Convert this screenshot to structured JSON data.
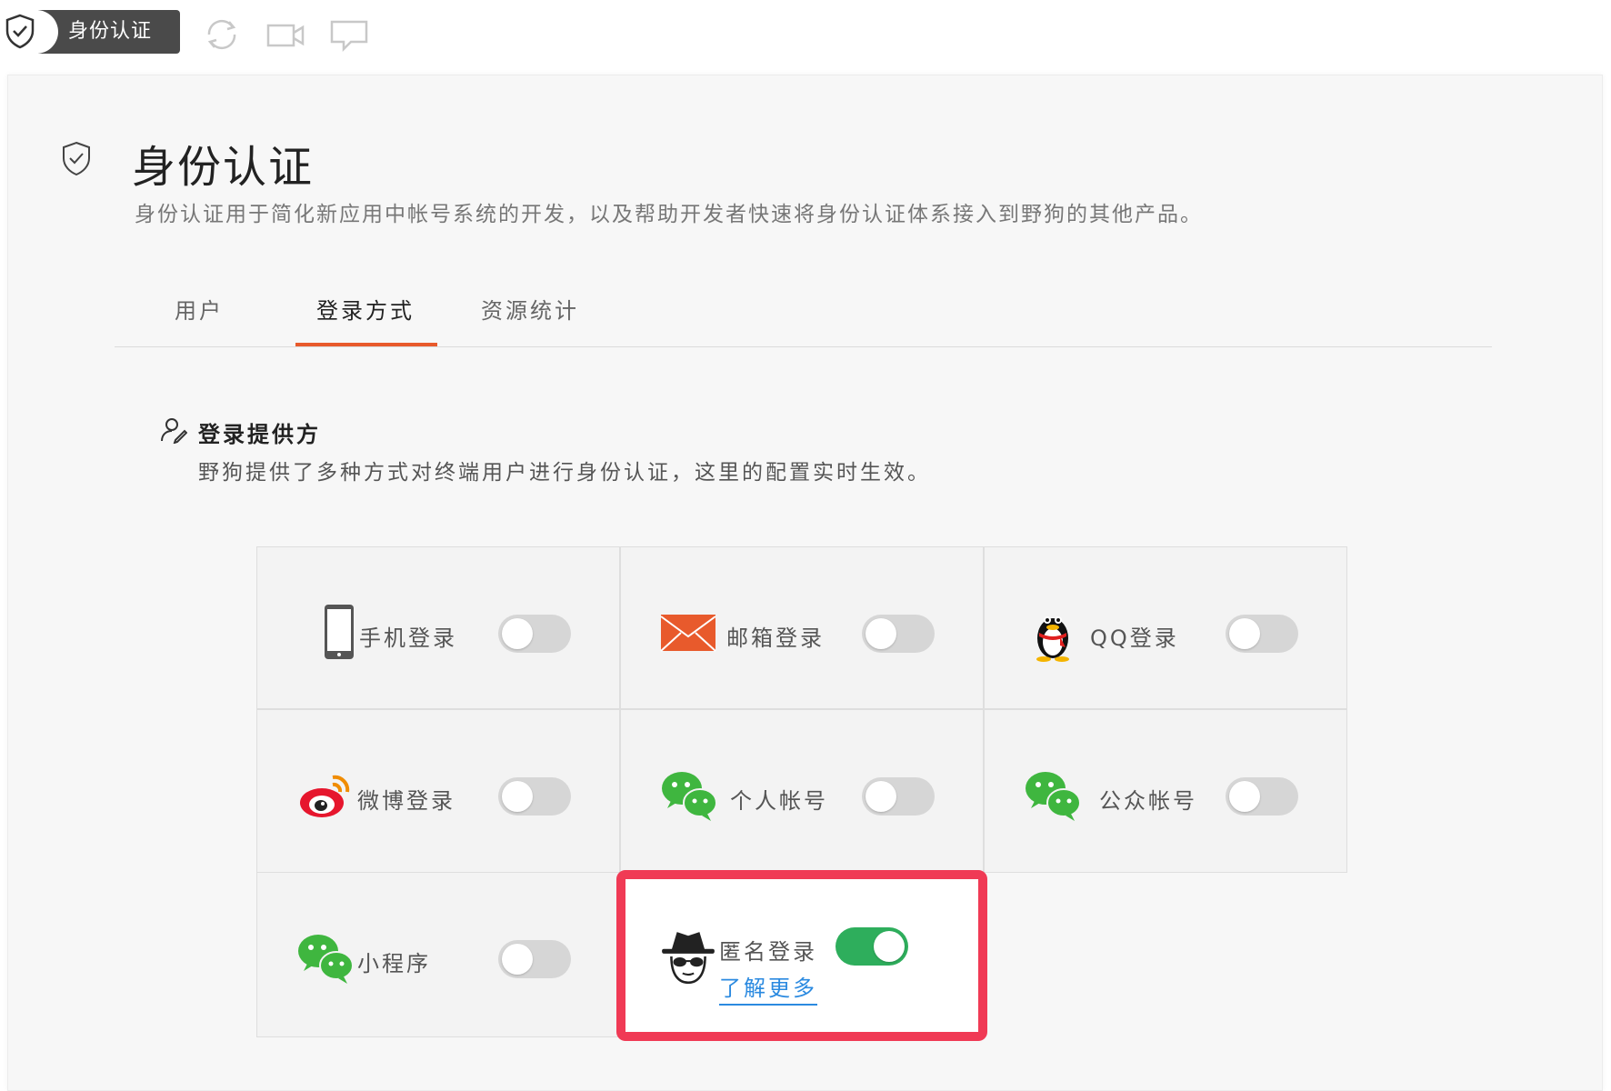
{
  "toolbar": {
    "active_tab": "身份认证",
    "icons": [
      "shield-icon",
      "refresh-icon",
      "video-icon",
      "chat-icon"
    ]
  },
  "header": {
    "title": "身份认证",
    "description": "身份认证用于简化新应用中帐号系统的开发，以及帮助开发者快速将身份认证体系接入到野狗的其他产品。"
  },
  "tabs": [
    {
      "label": "用户",
      "active": false
    },
    {
      "label": "登录方式",
      "active": true
    },
    {
      "label": "资源统计",
      "active": false
    }
  ],
  "section": {
    "title": "登录提供方",
    "description": "野狗提供了多种方式对终端用户进行身份认证，这里的配置实时生效。"
  },
  "providers": [
    {
      "label": "手机登录",
      "icon": "phone-icon",
      "enabled": false
    },
    {
      "label": "邮箱登录",
      "icon": "email-icon",
      "enabled": false
    },
    {
      "label": "QQ登录",
      "icon": "qq-icon",
      "enabled": false
    },
    {
      "label": "微博登录",
      "icon": "weibo-icon",
      "enabled": false
    },
    {
      "label": "个人帐号",
      "icon": "wechat-icon",
      "enabled": false
    },
    {
      "label": "公众帐号",
      "icon": "wechat-icon",
      "enabled": false
    },
    {
      "label": "小程序",
      "icon": "wechat-icon",
      "enabled": false
    },
    {
      "label": "匿名登录",
      "icon": "anonymous-icon",
      "enabled": true,
      "link": "了解更多"
    }
  ],
  "colors": {
    "accent": "#e85a2c",
    "toggle_on": "#2eae5c",
    "highlight": "#f03a55",
    "link": "#2b8ae0"
  }
}
